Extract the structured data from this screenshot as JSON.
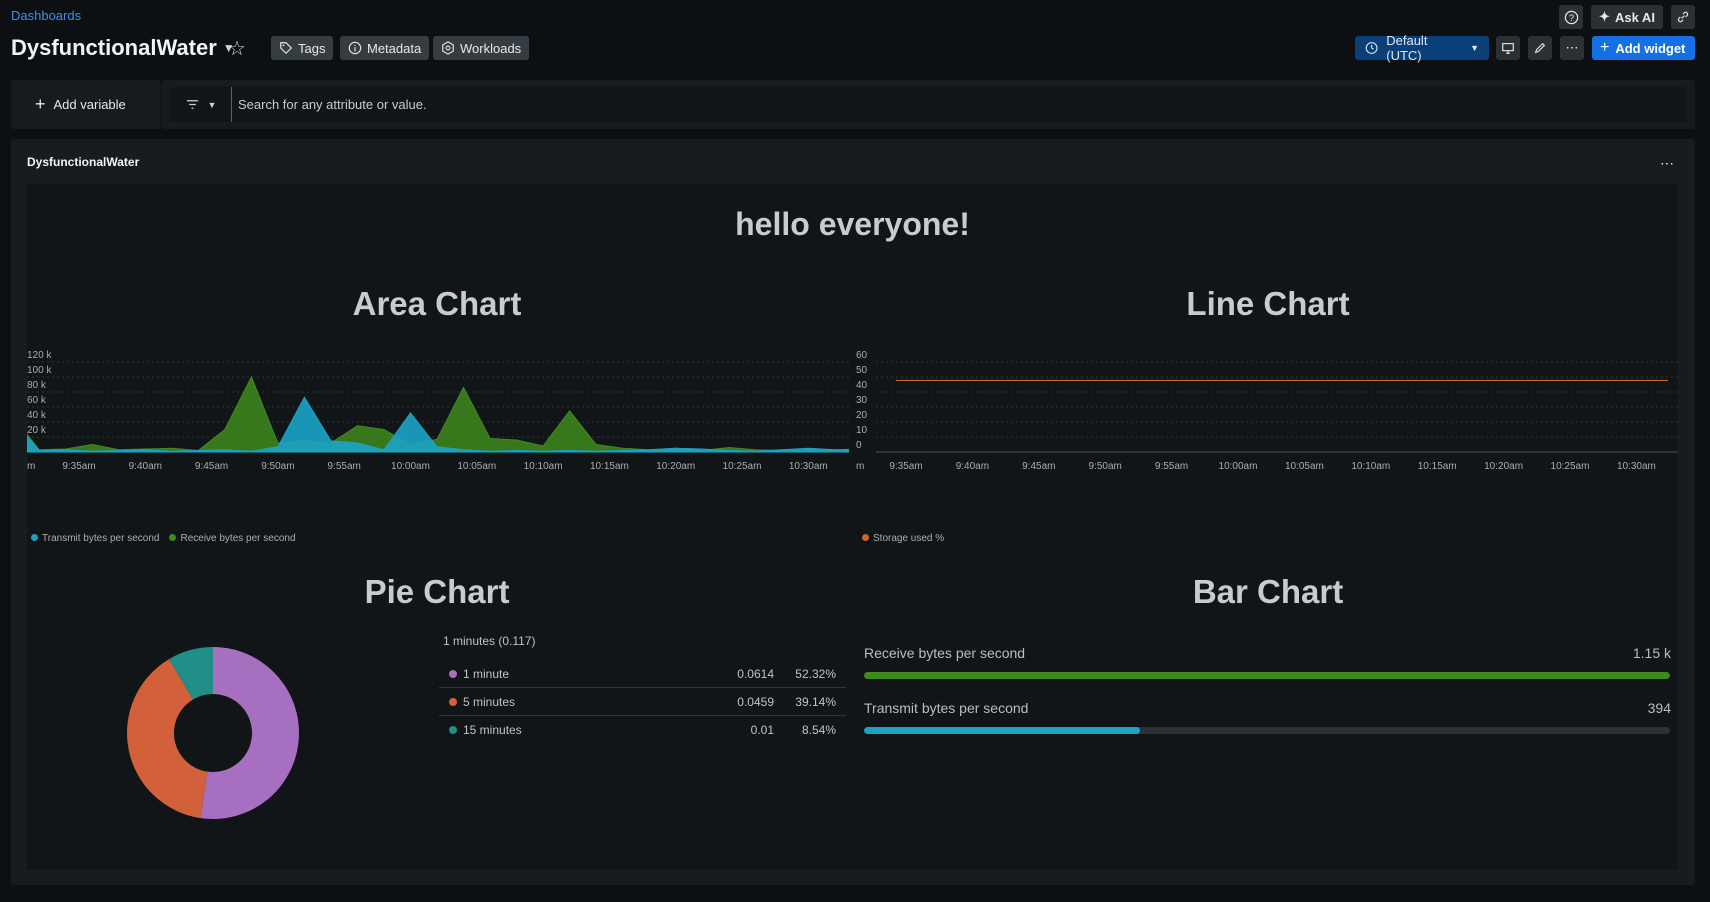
{
  "header": {
    "breadcrumb": "Dashboards",
    "title": "DysfunctionalWater",
    "chips": [
      {
        "label": "Tags",
        "icon": "tag-icon"
      },
      {
        "label": "Metadata",
        "icon": "info-icon"
      },
      {
        "label": "Workloads",
        "icon": "hexagon-icon"
      }
    ],
    "ask_ai": "Ask AI",
    "timezone": "Default (UTC)",
    "add_widget": "Add widget"
  },
  "filters": {
    "add_variable": "Add variable",
    "search_placeholder": "Search for any attribute or value."
  },
  "panel": {
    "title": "DysfunctionalWater",
    "heading": "hello everyone!"
  },
  "colors": {
    "transmit": "#1ba3c6",
    "receive": "#3f8a1d",
    "storage": "#c96a2b",
    "pie_1m": "#a66fbf",
    "pie_5m": "#d2603a",
    "pie_15m": "#1f8f87",
    "accent": "#1570e3"
  },
  "chart_data": [
    {
      "type": "area",
      "title": "Area Chart",
      "x": [
        "9:35am",
        "9:40am",
        "9:45am",
        "9:50am",
        "9:55am",
        "10:00am",
        "10:05am",
        "10:10am",
        "10:15am",
        "10:20am",
        "10:25am",
        "10:30am"
      ],
      "yticks": [
        "0",
        "20 k",
        "40 k",
        "60 k",
        "80 k",
        "100 k",
        "120 k"
      ],
      "ylim": [
        0,
        120000
      ],
      "x_range_minutes": [
        -36.5,
        25.5
      ],
      "series": [
        {
          "name": "Transmit bytes per second",
          "points": [
            [
              -36.5,
              0
            ],
            [
              -33,
              0
            ],
            [
              -32,
              0
            ],
            [
              -30,
              42000
            ],
            [
              -28,
              28000
            ],
            [
              -26,
              18000
            ],
            [
              -24,
              2000
            ],
            [
              -22,
              3000
            ],
            [
              -20,
              1000
            ],
            [
              -18,
              2000
            ],
            [
              -16,
              3000
            ],
            [
              -14,
              1000
            ],
            [
              -12,
              2000
            ],
            [
              -10,
              10000
            ],
            [
              -9,
              48000
            ],
            [
              -7,
              10000
            ],
            [
              -6,
              2000
            ],
            [
              -5,
              42000
            ],
            [
              -3,
              2000
            ],
            [
              -1,
              3000
            ],
            [
              1,
              1000
            ],
            [
              3,
              2000
            ],
            [
              5,
              3000
            ],
            [
              7,
              1000
            ],
            [
              9,
              2000
            ],
            [
              11,
              3000
            ],
            [
              13,
              1000
            ],
            [
              15,
              7000
            ],
            [
              17,
              73000
            ],
            [
              19,
              15000
            ],
            [
              21,
              12000
            ],
            [
              23,
              3000
            ],
            [
              25,
              52000
            ],
            [
              27,
              7000
            ],
            [
              29,
              3000
            ],
            [
              31,
              1000
            ],
            [
              33,
              2000
            ],
            [
              35,
              1000
            ],
            [
              37,
              2000
            ],
            [
              39,
              1000
            ],
            [
              41,
              2000
            ],
            [
              43,
              3000
            ],
            [
              45,
              5000
            ],
            [
              47,
              4000
            ],
            [
              49,
              2000
            ],
            [
              51,
              1000
            ],
            [
              53,
              3000
            ],
            [
              55,
              5000
            ],
            [
              57,
              3000
            ],
            [
              59,
              4000
            ],
            [
              61,
              1000
            ],
            [
              63,
              5000
            ],
            [
              64,
              22000
            ],
            [
              65.5,
              8000
            ],
            [
              66,
              2000
            ]
          ]
        },
        {
          "name": "Receive bytes per second",
          "points": [
            [
              -36.5,
              0
            ],
            [
              -33,
              0
            ],
            [
              -32,
              0
            ],
            [
              -30,
              40000
            ],
            [
              -28,
              26000
            ],
            [
              -26,
              20000
            ],
            [
              -24,
              2000
            ],
            [
              -22,
              4000
            ],
            [
              -20,
              2000
            ],
            [
              -18,
              3000
            ],
            [
              -16,
              5000
            ],
            [
              -14,
              2000
            ],
            [
              -12,
              3000
            ],
            [
              -10,
              12000
            ],
            [
              -9,
              55000
            ],
            [
              -7,
              15000
            ],
            [
              -6,
              3000
            ],
            [
              -5,
              48000
            ],
            [
              -3,
              3000
            ],
            [
              -1,
              4000
            ],
            [
              1,
              10000
            ],
            [
              3,
              3000
            ],
            [
              5,
              4000
            ],
            [
              7,
              5000
            ],
            [
              9,
              2000
            ],
            [
              11,
              30000
            ],
            [
              13,
              100000
            ],
            [
              15,
              12000
            ],
            [
              17,
              15000
            ],
            [
              19,
              12000
            ],
            [
              21,
              35000
            ],
            [
              23,
              30000
            ],
            [
              25,
              10000
            ],
            [
              27,
              17000
            ],
            [
              29,
              86000
            ],
            [
              31,
              18000
            ],
            [
              33,
              16000
            ],
            [
              35,
              8000
            ],
            [
              37,
              55000
            ],
            [
              39,
              10000
            ],
            [
              41,
              5000
            ],
            [
              43,
              3000
            ],
            [
              45,
              5000
            ],
            [
              47,
              2000
            ],
            [
              49,
              6000
            ],
            [
              51,
              3000
            ],
            [
              53,
              2000
            ],
            [
              55,
              3000
            ],
            [
              57,
              2000
            ],
            [
              59,
              3000
            ],
            [
              61,
              5000
            ],
            [
              63,
              8000
            ],
            [
              65,
              14000
            ],
            [
              67,
              12000
            ],
            [
              69,
              6000
            ],
            [
              71,
              3000
            ],
            [
              73,
              2000
            ],
            [
              75,
              21000
            ],
            [
              77,
              18000
            ],
            [
              79,
              28000
            ],
            [
              81,
              18000
            ],
            [
              83,
              98000
            ],
            [
              85,
              28000
            ],
            [
              86,
              8000
            ],
            [
              87,
              2000
            ]
          ]
        }
      ]
    },
    {
      "type": "line",
      "title": "Line Chart",
      "x": [
        "9:35am",
        "9:40am",
        "9:45am",
        "9:50am",
        "9:55am",
        "10:00am",
        "10:05am",
        "10:10am",
        "10:15am",
        "10:20am",
        "10:25am",
        "10:30am"
      ],
      "yticks": [
        "0",
        "10",
        "20",
        "30",
        "40",
        "50",
        "60"
      ],
      "ylim": [
        0,
        60
      ],
      "series": [
        {
          "name": "Storage used %",
          "value": 47.7
        }
      ]
    },
    {
      "type": "pie",
      "title": "Pie Chart",
      "summary": "1 minutes (0.117)",
      "rows": [
        {
          "label": "1 minute",
          "value": "0.0614",
          "pct": "52.32%",
          "share": 52.32
        },
        {
          "label": "5 minutes",
          "value": "0.0459",
          "pct": "39.14%",
          "share": 39.14
        },
        {
          "label": "15 minutes",
          "value": "0.01",
          "pct": "8.54%",
          "share": 8.54
        }
      ]
    },
    {
      "type": "bar",
      "title": "Bar Chart",
      "bars": [
        {
          "label": "Receive bytes per second",
          "display": "1.15 k",
          "value": 1150
        },
        {
          "label": "Transmit bytes per second",
          "display": "394",
          "value": 394
        }
      ],
      "max": 1150
    }
  ],
  "line_x_cut_label": "m"
}
